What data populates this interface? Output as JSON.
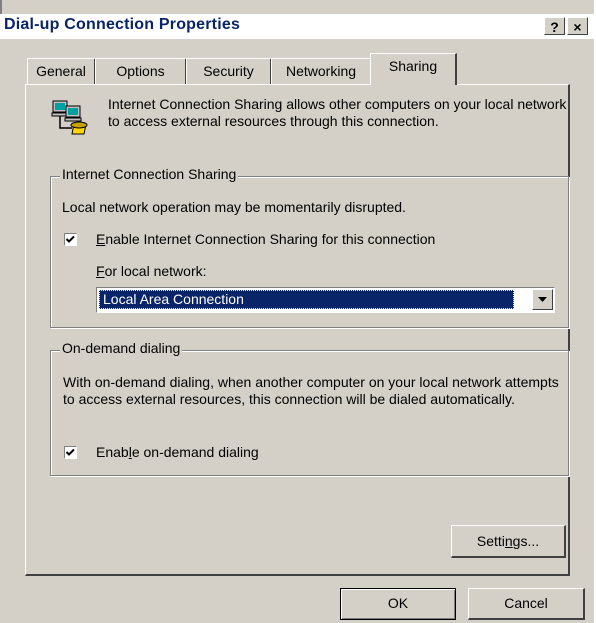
{
  "window": {
    "title": "Dial-up Connection Properties",
    "help_label": "?",
    "close_label": "×"
  },
  "tabs": [
    {
      "label": "General"
    },
    {
      "label": "Options"
    },
    {
      "label": "Security"
    },
    {
      "label": "Networking"
    },
    {
      "label": "Sharing",
      "active": true
    }
  ],
  "intro": {
    "text": "Internet Connection Sharing allows other computers on your local network to access external resources through this connection.",
    "icon": "network-computers-icon"
  },
  "ics_group": {
    "label": "Internet Connection Sharing",
    "notice": "Local network operation may be momentarily disrupted.",
    "enable_checkbox": {
      "label_prefix": "",
      "mnemonic": "E",
      "label_rest": "nable Internet Connection Sharing for this connection",
      "checked": true
    },
    "local_network_label_mnemonic": "F",
    "local_network_label_rest": "or local network:",
    "local_network_value": "Local Area Connection"
  },
  "dialing_group": {
    "label": "On-demand dialing",
    "description": "With on-demand dialing, when another computer on your local network attempts to access external resources, this connection will be dialed automatically.",
    "enable_checkbox": {
      "label_prefix": "Enab",
      "mnemonic": "l",
      "label_rest": "e on-demand dialing",
      "checked": true
    }
  },
  "buttons": {
    "settings_prefix": "Setti",
    "settings_mnemonic": "n",
    "settings_rest": "gs...",
    "ok": "OK",
    "cancel": "Cancel"
  },
  "colors": {
    "title_text": "#0a246a",
    "selection": "#0a246a",
    "face": "#d4d0c8"
  }
}
